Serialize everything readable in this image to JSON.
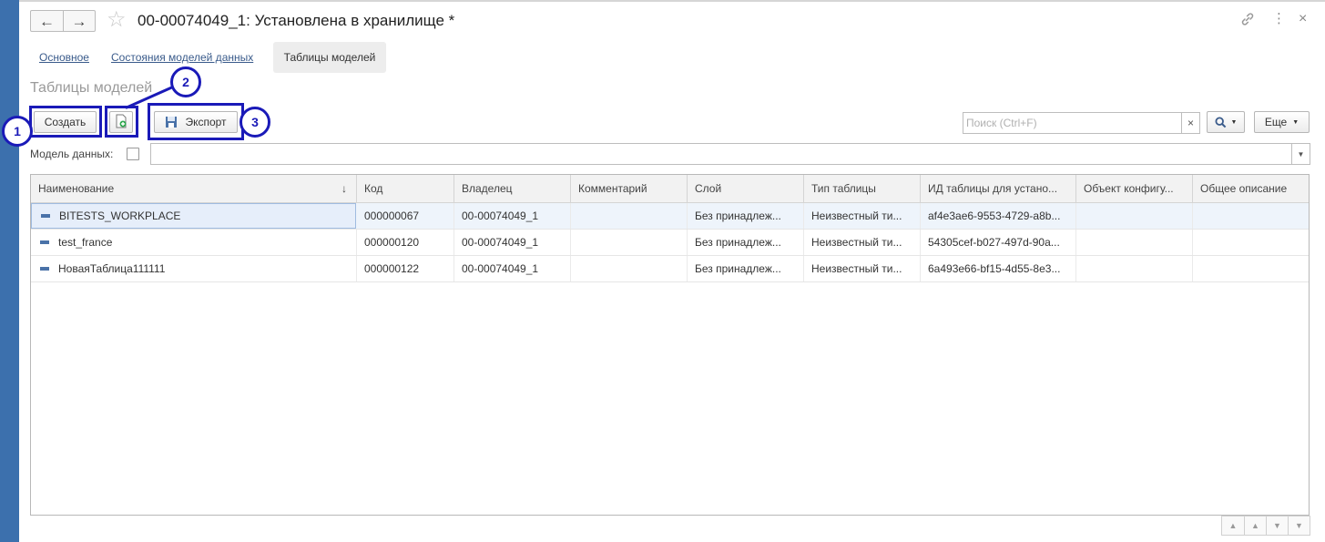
{
  "window": {
    "title": "00-00074049_1: Установлена в хранилище *",
    "back_icon": "←",
    "forward_icon": "→",
    "star_icon": "☆",
    "link_icon": "🔗",
    "more_icon": "⋮",
    "close_icon": "×"
  },
  "tabs": [
    {
      "label": "Основное"
    },
    {
      "label": "Состояния моделей данных"
    },
    {
      "label": "Таблицы моделей"
    }
  ],
  "section_title": "Таблицы моделей",
  "toolbar": {
    "create_label": "Создать",
    "export_label": "Экспорт",
    "search_placeholder": "Поиск (Ctrl+F)",
    "search_clear": "×",
    "search_icon": "🔍",
    "more_label": "Еще"
  },
  "callouts": [
    "1",
    "2",
    "3"
  ],
  "filter": {
    "label": "Модель данных:",
    "value": ""
  },
  "table": {
    "columns": [
      "Наименование",
      "Код",
      "Владелец",
      "Комментарий",
      "Слой",
      "Тип таблицы",
      "ИД таблицы для устано...",
      "Объект конфигу...",
      "Общее описание"
    ],
    "sort_indicator": "↓",
    "rows": [
      {
        "name": "BITESTS_WORKPLACE",
        "code": "000000067",
        "owner": "00-00074049_1",
        "comment": "",
        "layer": "Без принадлеж...",
        "type": "Неизвестный ти...",
        "table_id": "af4e3ae6-9553-4729-a8b...",
        "config_object": "",
        "description": ""
      },
      {
        "name": "test_france",
        "code": "000000120",
        "owner": "00-00074049_1",
        "comment": "",
        "layer": "Без принадлеж...",
        "type": "Неизвестный ти...",
        "table_id": "54305cef-b027-497d-90a...",
        "config_object": "",
        "description": ""
      },
      {
        "name": "НоваяТаблица111111",
        "code": "000000122",
        "owner": "00-00074049_1",
        "comment": "",
        "layer": "Без принадлеж...",
        "type": "Неизвестный ти...",
        "table_id": "6a493e66-bf15-4d55-8e3...",
        "config_object": "",
        "description": ""
      }
    ]
  },
  "colors": {
    "accent_highlight": "#1a1ab8",
    "link": "#3a5b8b",
    "left_strip": "#3c70ad"
  }
}
